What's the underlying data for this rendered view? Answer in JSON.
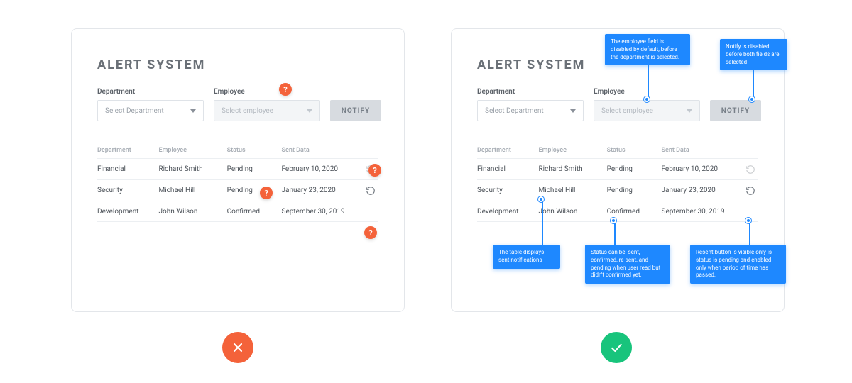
{
  "title": "ALERT SYSTEM",
  "form": {
    "department_label": "Department",
    "department_placeholder": "Select Department",
    "employee_label": "Employee",
    "employee_placeholder": "Select employee",
    "notify_label": "NOTIFY"
  },
  "table": {
    "headers": {
      "department": "Department",
      "employee": "Employee",
      "status": "Status",
      "sent_data": "Sent Data"
    },
    "rows": [
      {
        "department": "Financial",
        "employee": "Richard Smith",
        "status": "Pending",
        "sent_data": "February 10, 2020",
        "resend_visible": true,
        "resend_enabled": false
      },
      {
        "department": "Security",
        "employee": "Michael Hill",
        "status": "Pending",
        "sent_data": "January 23, 2020",
        "resend_visible": true,
        "resend_enabled": true
      },
      {
        "department": "Development",
        "employee": "John Wilson",
        "status": "Confirmed",
        "sent_data": "September 30, 2019",
        "resend_visible": false,
        "resend_enabled": false
      }
    ]
  },
  "annotations": {
    "employee_disabled": "The employee field is disabled by default, before the department is selected.",
    "notify_disabled": "Notify is disabled before both fields are selected",
    "table_purpose": "The table displays sent notifications",
    "status_values": "Status can be: sent, confirmed, re-sent, and pending when user read but didn't confirmed yet.",
    "resend_logic": "Resent button is visible only is status is pending and enabled only when period of time has passed."
  },
  "verdict": {
    "bad": "wrong",
    "good": "correct"
  }
}
